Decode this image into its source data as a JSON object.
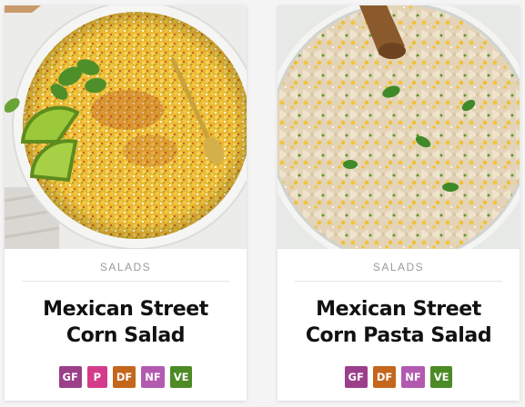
{
  "cards": [
    {
      "category": "SALADS",
      "title_line1": "Mexican Street",
      "title_line2": "Corn Salad",
      "badges": [
        "GF",
        "P",
        "DF",
        "NF",
        "VE"
      ]
    },
    {
      "category": "SALADS",
      "title_line1": "Mexican Street",
      "title_line2": "Corn Pasta Salad",
      "badges": [
        "GF",
        "DF",
        "NF",
        "VE"
      ]
    }
  ],
  "badge_colors": {
    "GF": "#9b3f8a",
    "P": "#d43c8a",
    "DF": "#c4661c",
    "NF": "#b25ab0",
    "VE": "#4c8a26"
  }
}
